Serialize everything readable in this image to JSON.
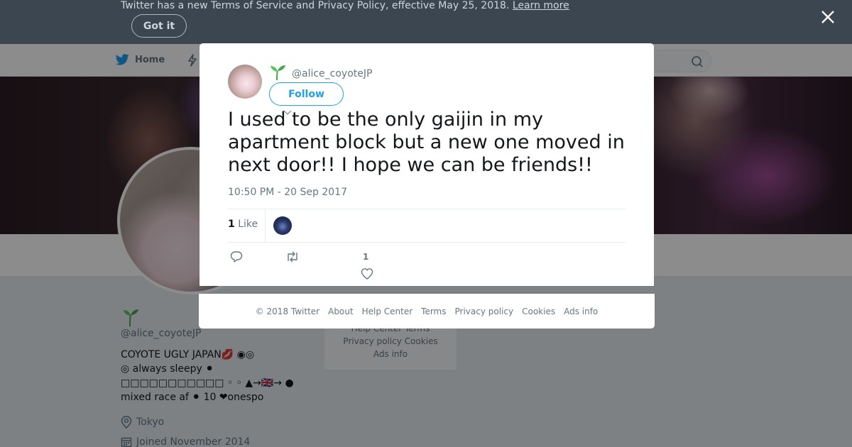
{
  "banner": {
    "text": "Twitter has a new Terms of Service and Privacy Policy, effective May 25, 2018.",
    "link": "Learn more",
    "got_it": "Got it"
  },
  "nav": {
    "home": "Home"
  },
  "profile": {
    "name": "⁡⁡⁡",
    "handle": "@alice_coyoteJP",
    "bio_lines": [
      "COYOTE UGLY JAPAN💋 ◉◎",
      "◎ always sleepy ⚫",
      "□□□□□□□□□□□ ◦ ◦ ▲→🇬🇧→ ●",
      "mixed race af ⚫ 10 ❤onespo"
    ],
    "location": "Tokyo",
    "joined": "Joined November 2014"
  },
  "side_footer": {
    "line1": "Help Center   Terms",
    "line2": "Privacy policy   Cookies",
    "line3": "Ads info"
  },
  "tweet": {
    "handle": "@alice_coyoteJP",
    "follow": "Follow",
    "text": "I used to be the only gaijin in my apartment block but a new one moved in next door!! I hope we can be friends!!",
    "time": "10:50 PM - 20 Sep 2017",
    "like_count": "1",
    "like_label": "Like",
    "heart_count": "1"
  },
  "footer": {
    "copyright": "© 2018 Twitter",
    "about": "About",
    "help": "Help Center",
    "terms": "Terms",
    "privacy": "Privacy policy",
    "cookies": "Cookies",
    "ads": "Ads info"
  },
  "colors": {
    "accent": "#1da1f2",
    "banner_bg": "#3c4650",
    "sprout": "#3fae49"
  },
  "icons": [
    "twitter-bird-icon",
    "moments-icon",
    "search-icon",
    "close-icon",
    "sprout-icon",
    "caret-down-icon",
    "reply-icon",
    "retweet-icon",
    "heart-icon",
    "location-icon",
    "calendar-icon"
  ]
}
